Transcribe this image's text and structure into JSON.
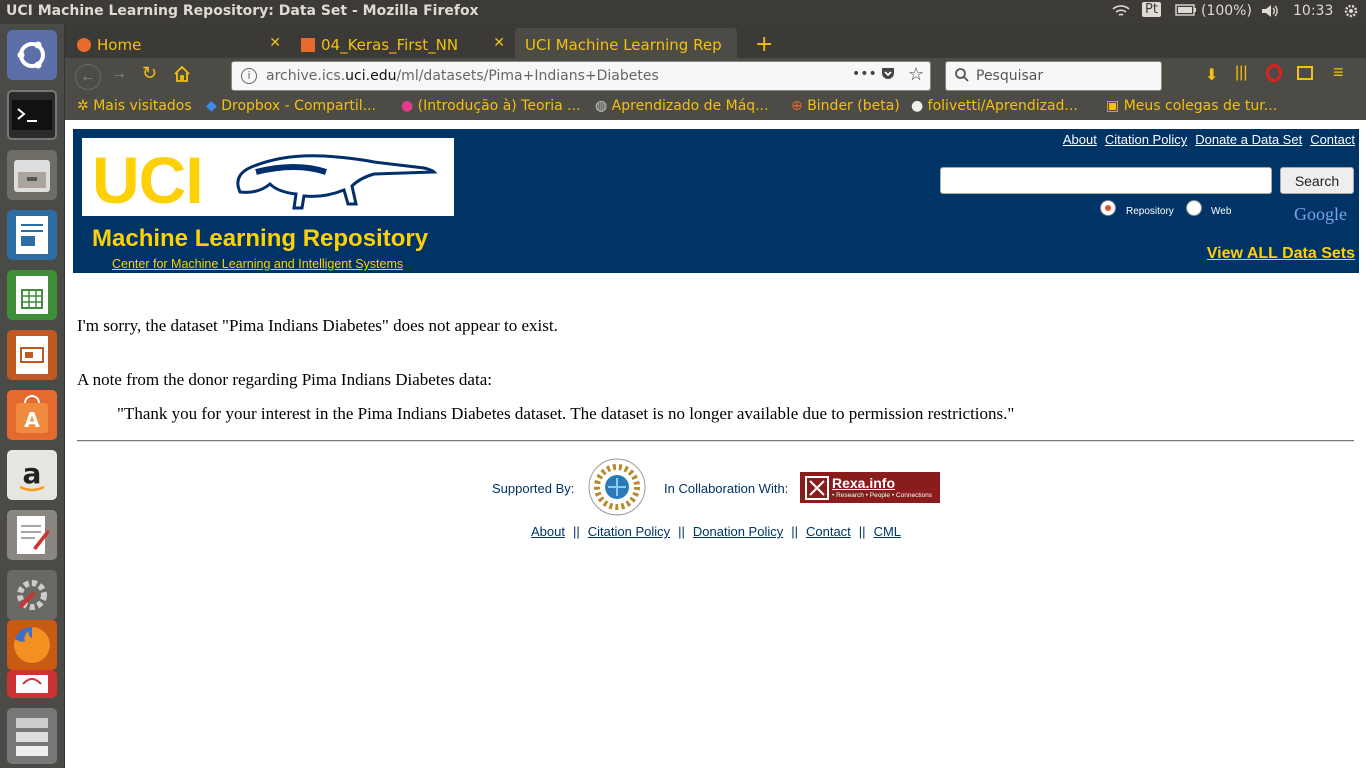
{
  "os": {
    "window_title": "UCI Machine Learning Repository: Data Set - Mozilla Firefox",
    "indicators": {
      "lang": "Pt",
      "battery": "(100%)",
      "clock": "10:33"
    }
  },
  "launcher": {
    "items": [
      "ubuntu-dash-icon",
      "terminal-icon",
      "files-icon",
      "writer-icon",
      "calc-icon",
      "impress-icon",
      "software-center-icon",
      "amazon-icon",
      "text-editor-icon",
      "settings-icon",
      "firefox-icon",
      "evince-icon",
      "workspaces-icon"
    ]
  },
  "browser": {
    "tabs": [
      {
        "label": "Home"
      },
      {
        "label": "04_Keras_First_NN"
      },
      {
        "label": "UCI Machine Learning Rep"
      }
    ],
    "url_prefix": "archive.ics.",
    "url_domain": "uci.edu",
    "url_path": "/ml/datasets/Pima+Indians+Diabetes",
    "search_placeholder": "Pesquisar",
    "bookmarks": [
      "Mais visitados",
      "Dropbox - Compartil...",
      "(Introdução à) Teoria ...",
      "Aprendizado de Máq...",
      "Binder (beta)",
      "folivetti/Aprendizad...",
      "Meus colegas de tur..."
    ]
  },
  "header": {
    "logo_text": "UCI",
    "repo_title": "Machine Learning Repository",
    "center_link": "Center for Machine Learning and Intelligent Systems",
    "top_links": [
      "About",
      "Citation Policy",
      "Donate a Data Set",
      "Contact"
    ],
    "search_button": "Search",
    "radio_repository": "Repository",
    "radio_web": "Web",
    "google": "Google",
    "view_all": "View ALL Data Sets"
  },
  "content": {
    "error": "I'm sorry, the dataset \"Pima Indians Diabetes\" does not appear to exist.",
    "note_heading": "A note from the donor regarding Pima Indians Diabetes data:",
    "note_text": "\"Thank you for your interest in the Pima Indians Diabetes dataset. The dataset is no longer available due to permission restrictions.\""
  },
  "footer": {
    "supported_by": "Supported By:",
    "collaboration": "In Collaboration With:",
    "rexa": "Rexa.info",
    "rexa_sub": "• Research • People • Connections",
    "links": [
      "About",
      "Citation Policy",
      "Donation Policy",
      "Contact",
      "CML"
    ],
    "separator": "||"
  },
  "colors": {
    "header_bg": "#003366",
    "accent_yellow": "#fdd106",
    "tab_text": "#f3c10f"
  }
}
